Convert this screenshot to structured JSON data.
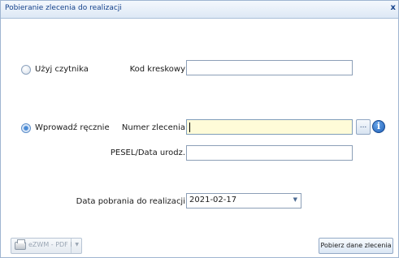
{
  "window": {
    "title": "Pobieranie zlecenia do realizacji",
    "close_glyph": "x"
  },
  "scanner_option": {
    "label": "Użyj czytnika",
    "selected": false,
    "barcode_label": "Kod kreskowy",
    "barcode_value": ""
  },
  "manual_option": {
    "label": "Wprowadź ręcznie",
    "selected": true,
    "order_number_label": "Numer zlecenia",
    "order_number_value": "",
    "browse_button_label": "...",
    "info_icon_glyph": "i",
    "pesel_label": "PESEL/Data urodz.",
    "pesel_value": ""
  },
  "fetch_date": {
    "label": "Data pobrania do realizacji",
    "value": "2021-02-17",
    "dropdown_glyph": "▼"
  },
  "footer": {
    "print_button_label": "eZWM - PDF I",
    "print_dropdown_glyph": "▼",
    "fetch_button_label": "Pobierz dane zlecenia"
  },
  "colors": {
    "title_text": "#15428b",
    "focused_field_bg": "#fefbd8",
    "info_icon": "#1f5fb8"
  }
}
